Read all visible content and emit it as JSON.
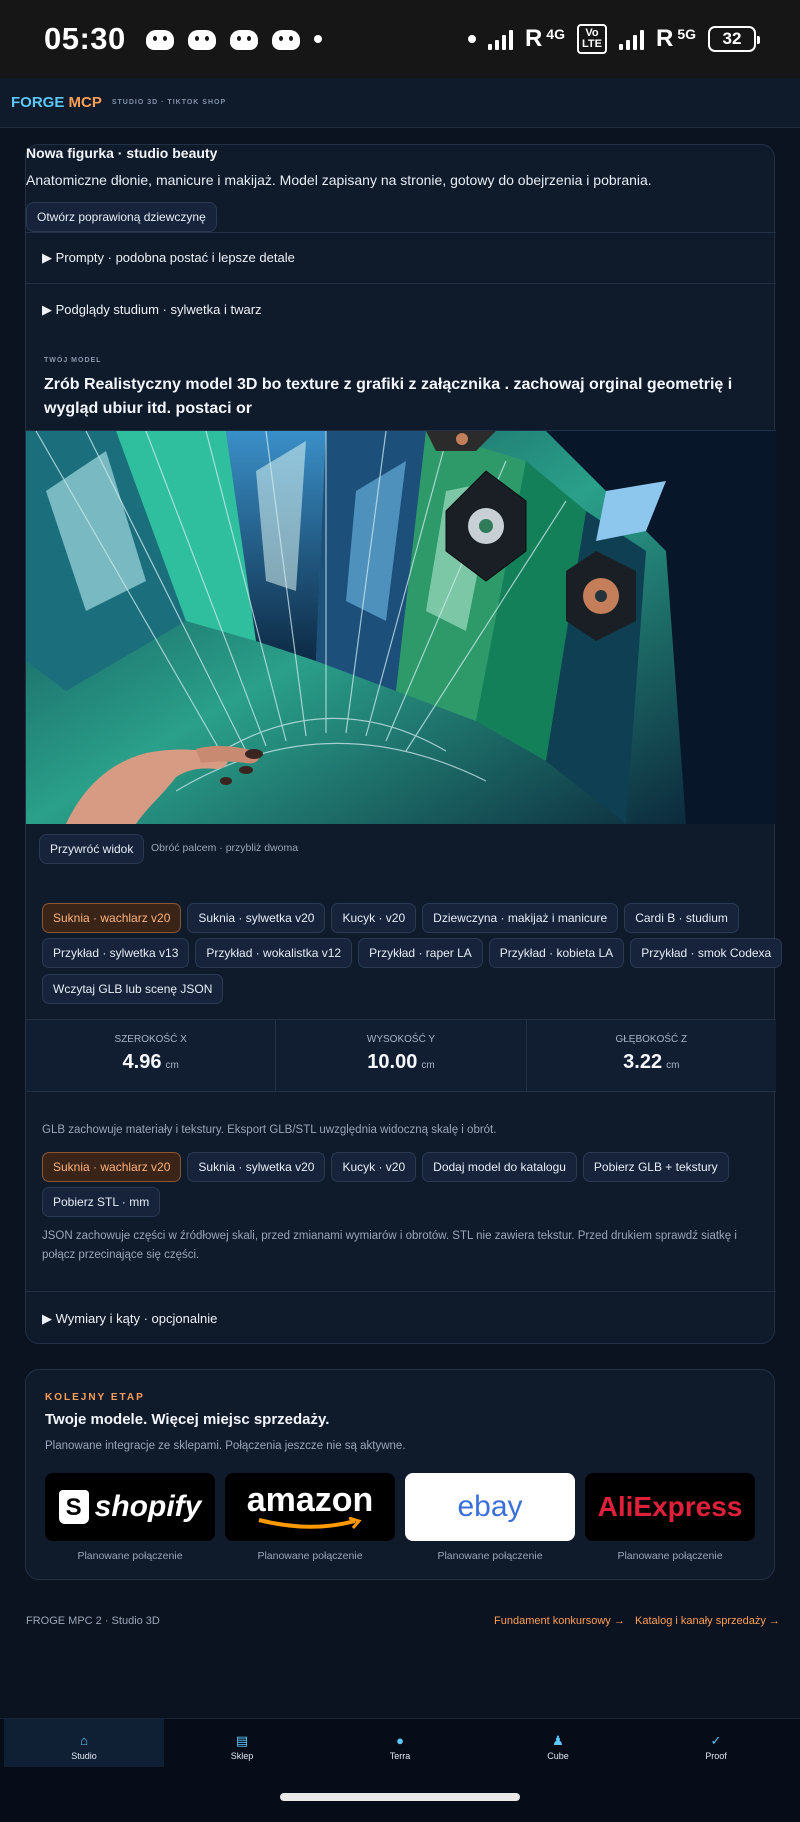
{
  "status": {
    "time": "05:30",
    "r1": "R",
    "net1": "4G",
    "volte": "Vo LTE",
    "r2": "R",
    "net2": "5G",
    "battery": "32"
  },
  "app": {
    "brand1": "FORGE ",
    "brand2": "MCP",
    "subtitle": "STUDIO 3D · TIKTOK SHOP"
  },
  "card": {
    "title": "Nowa figurka · studio beauty",
    "description": "Anatomiczne dłonie, manicure i makijaż. Model zapisany na stronie, gotowy do obejrzenia i pobrania.",
    "open_button": "Otwórz poprawioną dziewczynę",
    "summary_prompts": "▶ Prompty · podobna postać i lepsze detale",
    "summary_previews": "▶ Podglądy studium · sylwetka i twarz",
    "your_model_label": "TWÓJ MODEL",
    "prompt": "Zrób Realistyczny model 3D bo texture z grafiki z załącznika . zachowaj orginal geometrię i wygląd ubiur itd. postaci or",
    "reset_view": "Przywróć widok",
    "gesture_hint": "Obróć palcem · przybliż dwoma",
    "models": [
      "Suknia · wachlarz v20",
      "Suknia · sylwetka v20",
      "Kucyk · v20",
      "Dziewczyna · makijaż i manicure",
      "Cardi B · studium",
      "Przykład · sylwetka v13",
      "Przykład · wokalistka v12",
      "Przykład · raper LA",
      "Przykład · kobieta LA",
      "Przykład · smok Codexa",
      "Wczytaj GLB lub scenę JSON"
    ],
    "active_model": "Suknia · wachlarz v20",
    "dims": [
      {
        "label": "SZEROKOŚĆ X",
        "value": "4.96",
        "unit": "cm"
      },
      {
        "label": "WYSOKOŚĆ Y",
        "value": "10.00",
        "unit": "cm"
      },
      {
        "label": "GŁĘBOKOŚĆ Z",
        "value": "3.22",
        "unit": "cm"
      }
    ],
    "glb_note": "GLB zachowuje materiały i tekstury. Eksport GLB/STL uwzględnia widoczną skalę i obrót.",
    "export_buttons": [
      "Suknia · wachlarz v20",
      "Suknia · sylwetka v20",
      "Kucyk · v20",
      "Dodaj model do katalogu",
      "Pobierz GLB + tekstury",
      "Pobierz STL · mm"
    ],
    "json_note": "JSON zachowuje części w źródłowej skali, przed zmianami wymiarów i obrotów. STL nie zawiera tekstur. Przed drukiem sprawdź siatkę i połącz przecinające się części.",
    "summary_dims": "▶ Wymiary i kąty · opcjonalnie"
  },
  "sales": {
    "eyebrow": "KOLEJNY ETAP",
    "title": "Twoje modele. Więcej miejsc sprzedaży.",
    "subtitle": "Planowane integracje ze sklepami. Połączenia jeszcze nie są aktywne.",
    "stores": [
      {
        "name": "shopify",
        "caption": "Planowane połączenie"
      },
      {
        "name": "amazon",
        "caption": "Planowane połączenie"
      },
      {
        "name": "ebay",
        "caption": "Planowane połączenie"
      },
      {
        "name": "AliExpress",
        "caption": "Planowane połączenie"
      }
    ]
  },
  "footer": {
    "left": "FROGE MPC 2 · Studio 3D",
    "link1": "Fundament konkursowy →",
    "link2": "Katalog i kanały sprzedaży →"
  },
  "tabs": [
    {
      "label": "Studio",
      "icon": "home-icon"
    },
    {
      "label": "Sklep",
      "icon": "shop-icon"
    },
    {
      "label": "Terra",
      "icon": "terra-icon"
    },
    {
      "label": "Cube",
      "icon": "cube-icon"
    },
    {
      "label": "Proof",
      "icon": "check-icon"
    }
  ],
  "colors": {
    "accent": "#5cc8ff",
    "orange": "#ff9f55",
    "bg": "#0b1220"
  }
}
